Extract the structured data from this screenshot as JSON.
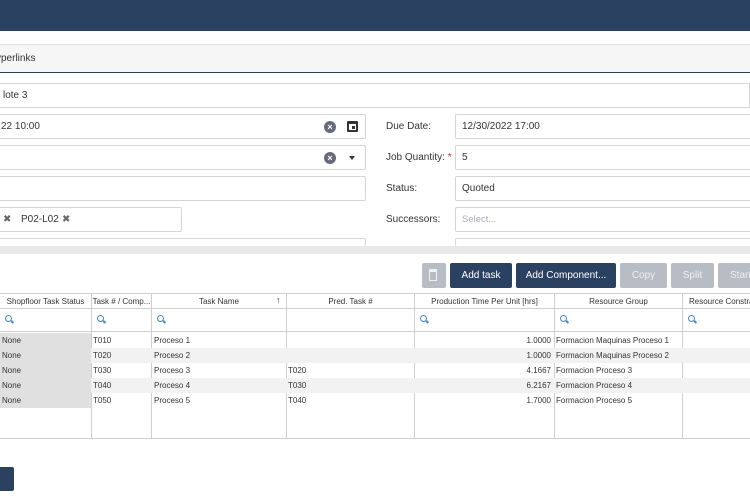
{
  "tabbar": {
    "label": "yperlinks"
  },
  "job_name": "lote 3",
  "form": {
    "start_date_value": "22 10:00",
    "due_date_label": "Due Date:",
    "due_date_value": "12/30/2022 17:00",
    "job_quantity_label": "Job Quantity:",
    "required_mark": "*",
    "job_quantity_value": "5",
    "status_label": "Status:",
    "status_value": "Quoted",
    "successors_label": "Successors:",
    "successors_placeholder": "Select...",
    "chip_label": "P02-L02"
  },
  "toolbar": {
    "add_task": "Add task",
    "add_component": "Add Component...",
    "copy": "Copy",
    "split": "Split",
    "start": "Start"
  },
  "grid": {
    "columns": [
      "Shopfloor Task Status",
      "Task # / Comp...",
      "Task Name",
      "Pred. Task #",
      "Production Time Per Unit [hrs]",
      "Resource Group",
      "Resource Constra"
    ],
    "rows": [
      {
        "status": "None",
        "task": "T010",
        "name": "Proceso 1",
        "pred": "",
        "time": "1.0000",
        "group": "Formacion Maquinas Proceso 1"
      },
      {
        "status": "None",
        "task": "T020",
        "name": "Proceso 2",
        "pred": "",
        "time": "1.0000",
        "group": "Formacion Maquinas Proceso 2"
      },
      {
        "status": "None",
        "task": "T030",
        "name": "Proceso 3",
        "pred": "T020",
        "time": "4.1667",
        "group": "Formacion Proceso 3"
      },
      {
        "status": "None",
        "task": "T040",
        "name": "Proceso 4",
        "pred": "T030",
        "time": "6.2167",
        "group": "Formacion Proceso 4"
      },
      {
        "status": "None",
        "task": "T050",
        "name": "Proceso 5",
        "pred": "T040",
        "time": "1.7000",
        "group": "Formacion Proceso 5"
      }
    ]
  },
  "colors": {
    "primary": "#2b4162",
    "disabled": "#b7bcc5",
    "link": "#4a86c5"
  }
}
